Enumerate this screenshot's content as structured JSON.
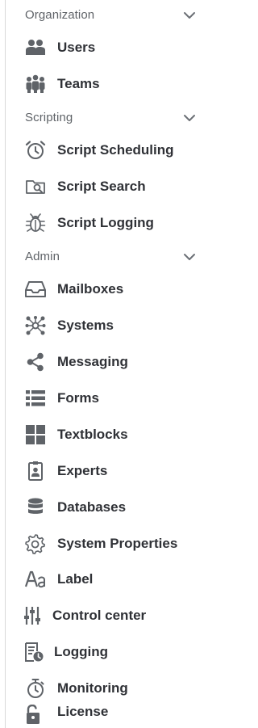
{
  "sections": [
    {
      "title": "Organization",
      "items": [
        {
          "label": "Users",
          "icon": "users-icon"
        },
        {
          "label": "Teams",
          "icon": "teams-icon"
        }
      ]
    },
    {
      "title": "Scripting",
      "items": [
        {
          "label": "Script Scheduling",
          "icon": "alarm-clock-icon"
        },
        {
          "label": "Script Search",
          "icon": "folder-search-icon"
        },
        {
          "label": "Script Logging",
          "icon": "bug-icon"
        }
      ]
    },
    {
      "title": "Admin",
      "items": [
        {
          "label": "Mailboxes",
          "icon": "inbox-tray-icon"
        },
        {
          "label": "Systems",
          "icon": "network-hub-icon"
        },
        {
          "label": "Messaging",
          "icon": "share-icon"
        },
        {
          "label": "Forms",
          "icon": "form-list-icon"
        },
        {
          "label": "Textblocks",
          "icon": "grid-blocks-icon"
        },
        {
          "label": "Experts",
          "icon": "badge-icon"
        },
        {
          "label": "Databases",
          "icon": "database-icon"
        },
        {
          "label": "System Properties",
          "icon": "gear-icon"
        },
        {
          "label": "Label",
          "icon": "font-aa-icon"
        },
        {
          "label": "Control center",
          "icon": "sliders-icon"
        },
        {
          "label": "Logging",
          "icon": "log-document-icon"
        },
        {
          "label": "Monitoring",
          "icon": "stopwatch-icon"
        },
        {
          "label": "License",
          "icon": "unlock-icon"
        }
      ]
    }
  ],
  "colors": {
    "icon": "#5f6368",
    "label": "#2f3136",
    "section_title": "#5f6368",
    "left_link": "#3b6fd1"
  }
}
